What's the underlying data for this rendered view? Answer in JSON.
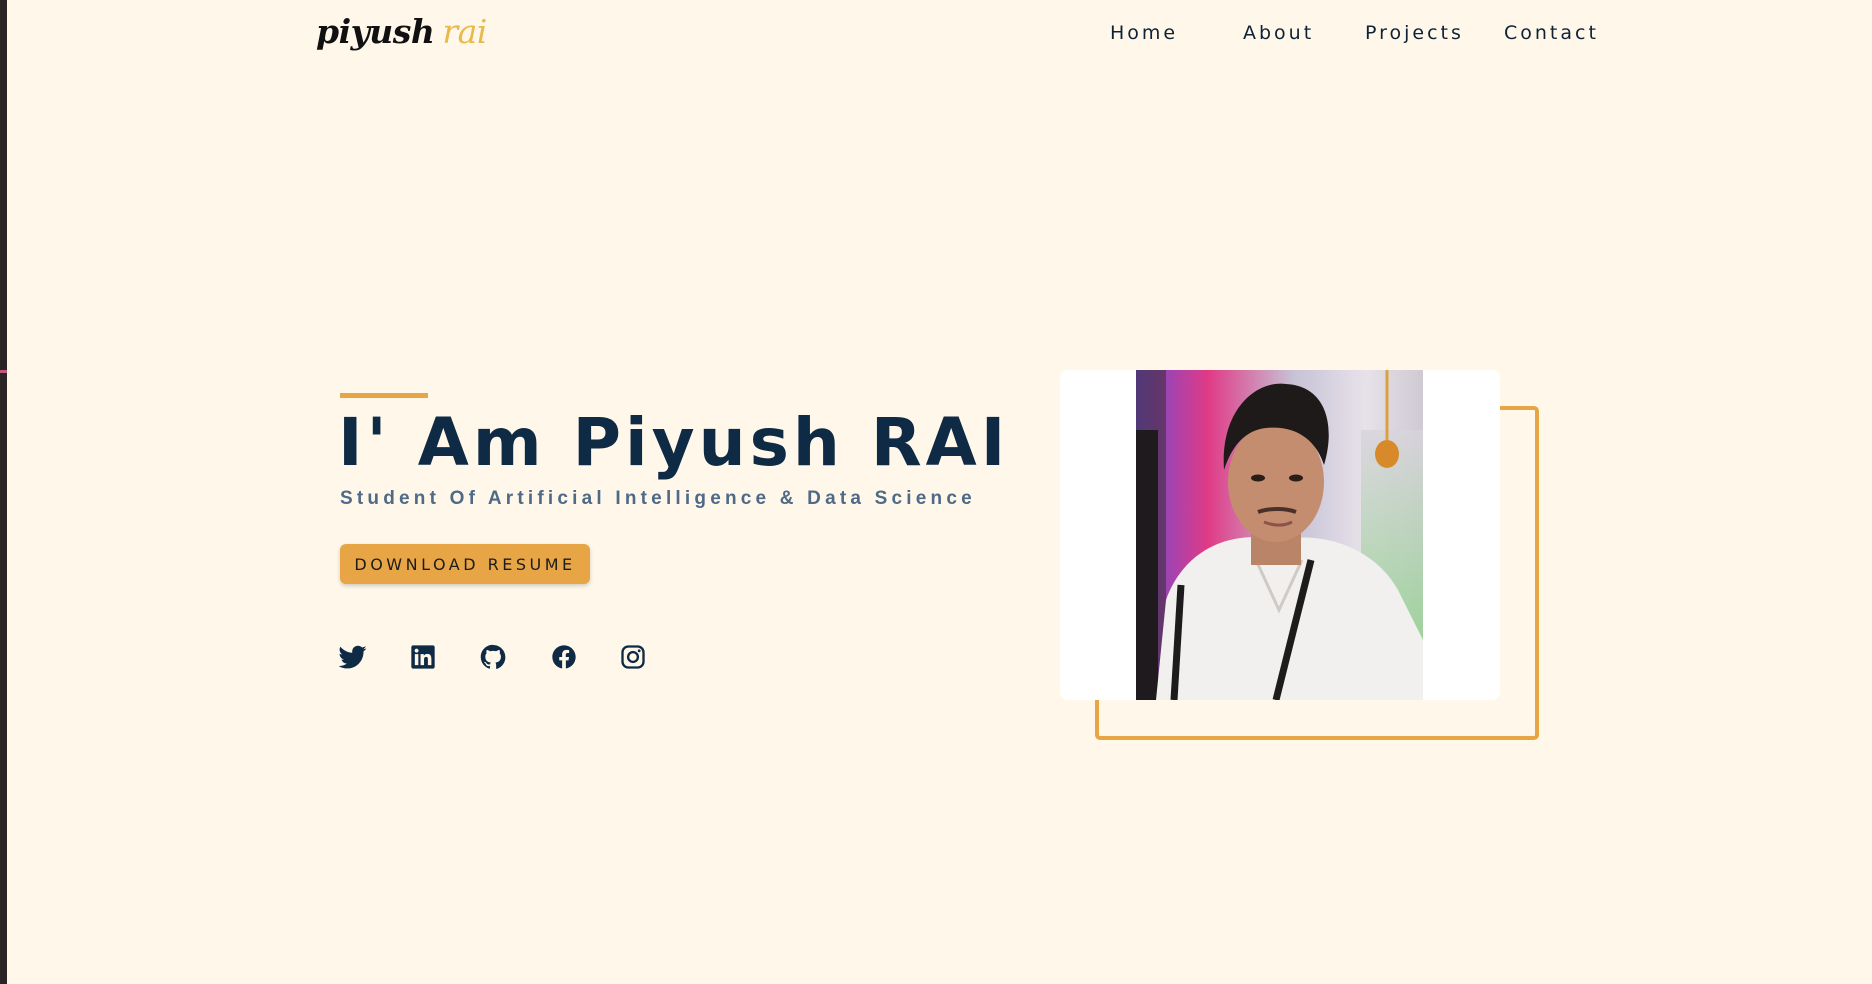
{
  "logo": {
    "first": "piyush",
    "second": "rai"
  },
  "nav": {
    "items": [
      "Home",
      "About",
      "Projects",
      "Contact"
    ]
  },
  "hero": {
    "title": "I' Am Piyush RAI",
    "subtitle": "Student Of Artificial Intelligence & Data Science",
    "button_label": "DOWNLOAD RESUME"
  },
  "socials": [
    "twitter-icon",
    "linkedin-icon",
    "github-icon",
    "facebook-icon",
    "instagram-icon"
  ],
  "colors": {
    "background": "#fff8ea",
    "accent": "#e8a545",
    "title": "#0e2a44",
    "subtitle": "#4f6a86",
    "nav_text": "#0e2236",
    "logo_accent": "#e9b949"
  }
}
